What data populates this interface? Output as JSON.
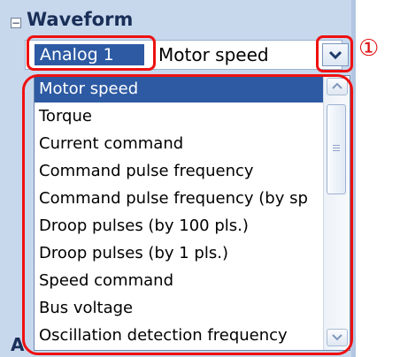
{
  "group": {
    "toggle": "−",
    "title": "Waveform"
  },
  "row": {
    "label": "Analog 1",
    "value": "Motor speed"
  },
  "callout_number": "①",
  "dropdown_items": [
    "Motor speed",
    "Torque",
    "Current command",
    "Command pulse frequency",
    "Command pulse frequency (by sp",
    "Droop pulses (by 100 pls.)",
    "Droop pulses (by 1 pls.)",
    "Speed command",
    "Bus voltage",
    "Oscillation detection frequency"
  ],
  "selected_index": 0,
  "next_group_initial": "A",
  "colors": {
    "selection": "#2d5aa3",
    "callout": "#ee1111",
    "panel": "#c7d8ed"
  }
}
